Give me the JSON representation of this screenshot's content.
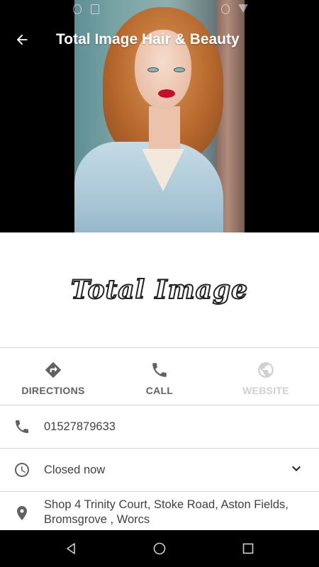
{
  "app_bar": {
    "title": "Total Image Hair & Beauty"
  },
  "logo": {
    "text": "Total Image"
  },
  "actions": [
    {
      "label": "DIRECTIONS",
      "icon": "directions-icon",
      "enabled": true
    },
    {
      "label": "CALL",
      "icon": "phone-icon",
      "enabled": true
    },
    {
      "label": "WEBSITE",
      "icon": "globe-icon",
      "enabled": false
    }
  ],
  "info": {
    "phone": "01527879633",
    "hours_status": "Closed now",
    "address_line1": "Shop 4 Trinity Court, Stoke Road, Aston Fields,",
    "address_line2": "Bromsgrove , Worcs"
  },
  "colors": {
    "icon": "#616161",
    "text": "#424242",
    "disabled": "#d0d0d0"
  }
}
